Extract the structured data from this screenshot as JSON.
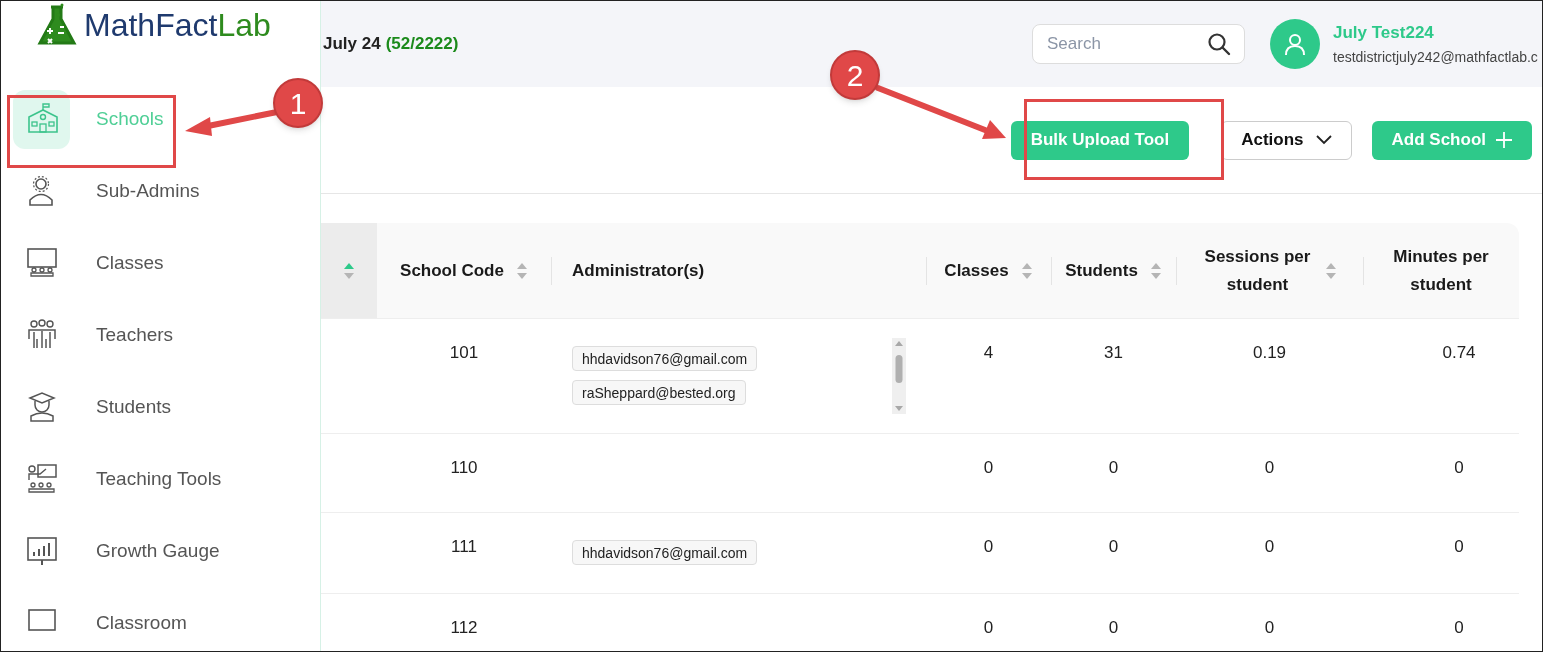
{
  "logo": {
    "text_1": "MathFact",
    "text_2": "Lab"
  },
  "header": {
    "title": "July 24",
    "count": "(52/2222)",
    "search": {
      "placeholder": "Search"
    },
    "user": {
      "name": "July Test224",
      "email": "testdistrictjuly242@mathfactlab.c"
    }
  },
  "sidebar": {
    "items": [
      {
        "label": "Schools",
        "selected": true
      },
      {
        "label": "Sub-Admins",
        "selected": false
      },
      {
        "label": "Classes",
        "selected": false
      },
      {
        "label": "Teachers",
        "selected": false
      },
      {
        "label": "Students",
        "selected": false
      },
      {
        "label": "Teaching Tools",
        "selected": false
      },
      {
        "label": "Growth Gauge",
        "selected": false
      },
      {
        "label": "Classroom",
        "selected": false
      }
    ]
  },
  "toolbar": {
    "buttons": [
      {
        "label": "Bulk Upload Tool",
        "kind": "primary"
      },
      {
        "label": "Actions",
        "kind": "dropdown"
      },
      {
        "label": "Add School",
        "kind": "add"
      }
    ]
  },
  "table": {
    "columns": [
      {
        "sortable": true,
        "sorted": true
      },
      {
        "label": "School Code",
        "sortable": true,
        "sorted": false
      },
      {
        "label": "Administrator(s)",
        "sortable": false,
        "sorted": false
      },
      {
        "label": "Classes",
        "sortable": true,
        "sorted": false
      },
      {
        "label": "Students",
        "sortable": true,
        "sorted": false
      },
      {
        "label": "Sessions per student",
        "sortable": true,
        "sorted": false
      },
      {
        "label": "Minutes per student",
        "sortable": false,
        "sorted": false
      }
    ],
    "rows": [
      {
        "code": "101",
        "admins": [
          "hhdavidson76@gmail.com",
          "raSheppard@bested.org"
        ],
        "scrollable": true,
        "classes": "4",
        "students": "31",
        "sessions": "0.19",
        "minutes": "0.74"
      },
      {
        "code": "110",
        "admins": [],
        "scrollable": false,
        "classes": "0",
        "students": "0",
        "sessions": "0",
        "minutes": "0"
      },
      {
        "code": "111",
        "admins": [
          "hhdavidson76@gmail.com"
        ],
        "scrollable": false,
        "classes": "0",
        "students": "0",
        "sessions": "0",
        "minutes": "0"
      },
      {
        "code": "112",
        "admins": [],
        "scrollable": false,
        "classes": "0",
        "students": "0",
        "sessions": "0",
        "minutes": "0"
      }
    ]
  },
  "annotations": [
    {
      "number": "1"
    },
    {
      "number": "2"
    }
  ]
}
